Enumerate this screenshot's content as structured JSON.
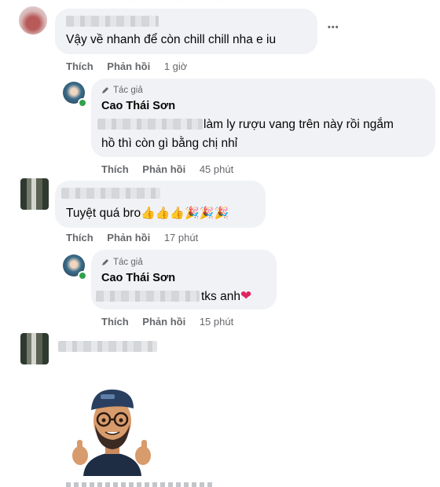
{
  "comments": [
    {
      "text": "Vậy về nhanh để còn chill chill nha e iu",
      "actions": {
        "like": "Thích",
        "reply": "Phản hồi",
        "time": "1 giờ"
      }
    },
    {
      "badge": "Tác giả",
      "name": "Cao Thái Sơn",
      "text_line1": "làm ly rượu vang trên này rồi ngắm",
      "text_line2": "hồ thì còn gì bằng chị nhỉ",
      "actions": {
        "like": "Thích",
        "reply": "Phản hồi",
        "time": "45 phút"
      }
    },
    {
      "text": "Tuyệt quá bro",
      "emojis": "👍👍👍🎉🎉🎉",
      "actions": {
        "like": "Thích",
        "reply": "Phản hồi",
        "time": "17 phút"
      }
    },
    {
      "badge": "Tác giả",
      "name": "Cao Thái Sơn",
      "text": "tks anh",
      "heart": "❤",
      "actions": {
        "like": "Thích",
        "reply": "Phản hồi",
        "time": "15 phút"
      }
    }
  ],
  "more_icon": "•••",
  "colors": {
    "bubble": "#f0f2f5",
    "muted": "#65676b",
    "online": "#31a24c",
    "heart": "#e0245e"
  }
}
